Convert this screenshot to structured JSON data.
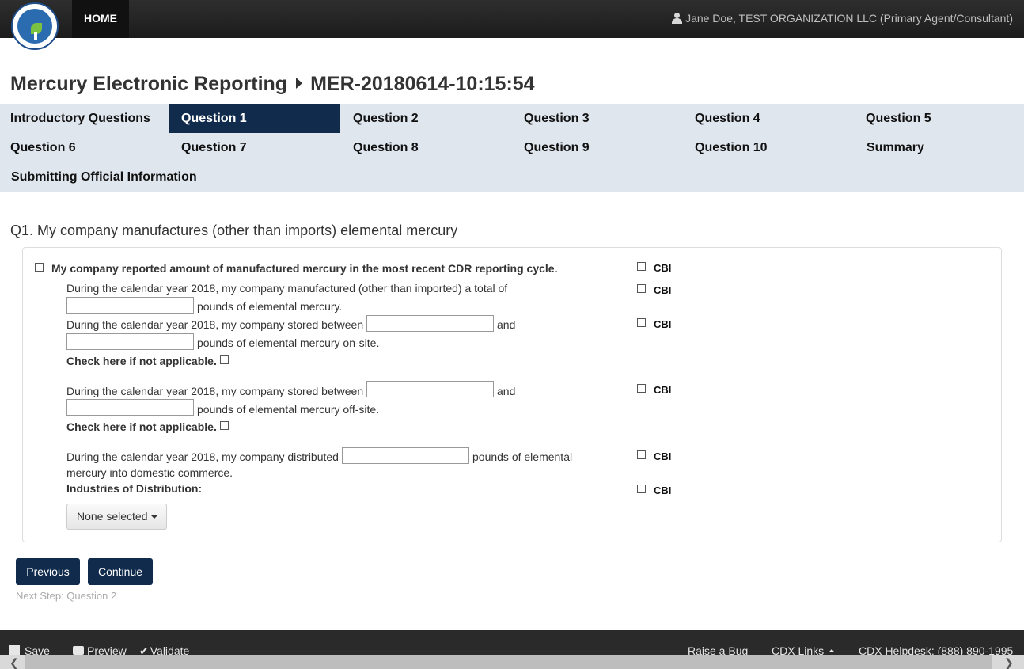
{
  "header": {
    "home_label": "HOME",
    "user_label": "Jane Doe, TEST ORGANIZATION LLC (Primary Agent/Consultant)"
  },
  "page": {
    "title_app": "Mercury Electronic Reporting",
    "title_id": "MER-20180614-10:15:54"
  },
  "nav": {
    "items": [
      {
        "label": "Introductory Questions"
      },
      {
        "label": "Question 1",
        "active": true
      },
      {
        "label": "Question 2"
      },
      {
        "label": "Question 3"
      },
      {
        "label": "Question 4"
      },
      {
        "label": "Question 5"
      },
      {
        "label": "Question 6"
      },
      {
        "label": "Question 7"
      },
      {
        "label": "Question 8"
      },
      {
        "label": "Question 9"
      },
      {
        "label": "Question 10"
      },
      {
        "label": "Summary"
      },
      {
        "label": "Submitting Official Information"
      }
    ]
  },
  "question": {
    "heading": "Q1. My company manufactures (other than imports) elemental mercury",
    "reported_cdr": "My company reported amount of manufactured mercury in the most recent CDR reporting cycle.",
    "manufactured_prefix": "During the calendar year 2018, my company manufactured (other than imported) a total of",
    "manufactured_suffix": "pounds of elemental mercury.",
    "stored_prefix": "During the calendar year 2018, my company stored between",
    "and_label": "and",
    "onsite_suffix": "pounds of elemental mercury on-site.",
    "offsite_suffix": "pounds of elemental mercury off-site.",
    "not_applicable": "Check here if not applicable.",
    "distributed_prefix": "During the calendar year 2018, my company distributed",
    "distributed_suffix": "pounds of elemental",
    "distributed_line2": "mercury into domestic commerce.",
    "industries_label": "Industries of Distribution:",
    "industries_dropdown": "None selected",
    "cbi_label": "CBI"
  },
  "actions": {
    "previous": "Previous",
    "continue": "Continue",
    "next_step": "Next Step: Question 2"
  },
  "footer": {
    "save": "Save",
    "preview": "Preview",
    "validate": "Validate",
    "raise_bug": "Raise a Bug",
    "cdx_links": "CDX Links",
    "helpdesk": "CDX Helpdesk: (888) 890-1995"
  },
  "colors": {
    "nav_active": "#102b4c",
    "nav_bg": "#dfe6ee",
    "button": "#102b4c"
  }
}
